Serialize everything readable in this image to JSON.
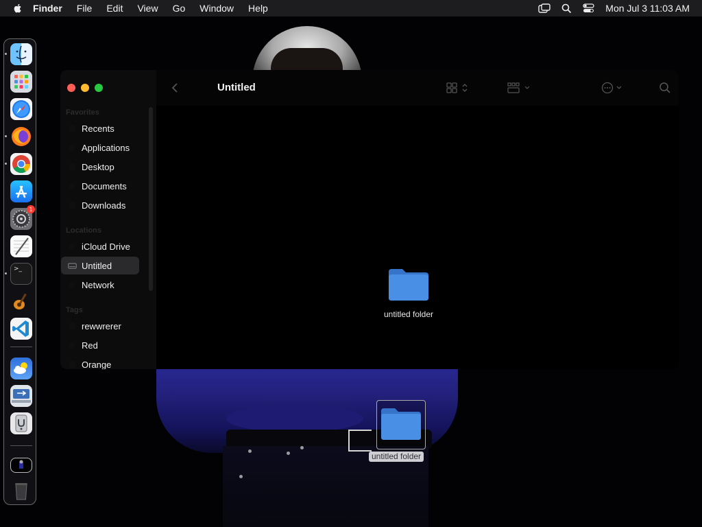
{
  "menubar": {
    "app_name": "Finder",
    "items": [
      "File",
      "Edit",
      "View",
      "Go",
      "Window",
      "Help"
    ],
    "clock": "Mon Jul 3  11:03 AM",
    "icons": [
      "screen-mirroring-icon",
      "spotlight-search-icon",
      "control-center-icon"
    ]
  },
  "dock": {
    "apps": [
      {
        "name": "Finder",
        "icon": "finder-icon"
      },
      {
        "name": "Launchpad",
        "icon": "launchpad-icon"
      },
      {
        "name": "Safari",
        "icon": "safari-icon"
      },
      {
        "name": "Firefox",
        "icon": "firefox-icon"
      },
      {
        "name": "Google Chrome",
        "icon": "chrome-icon"
      },
      {
        "name": "App Store",
        "icon": "app-store-icon"
      },
      {
        "name": "System Settings",
        "icon": "system-settings-icon",
        "badge": "1"
      },
      {
        "name": "TextEdit",
        "icon": "textedit-icon"
      },
      {
        "name": "Terminal",
        "icon": "terminal-icon",
        "glyph": ">_"
      },
      {
        "name": "GarageBand",
        "icon": "garageband-icon"
      },
      {
        "name": "Visual Studio Code",
        "icon": "vscode-icon"
      },
      {
        "name": "Weather",
        "icon": "weather-icon"
      },
      {
        "name": "Migration Assistant",
        "icon": "migration-assistant-icon"
      },
      {
        "name": "Disk Utility",
        "icon": "disk-utility-icon"
      },
      {
        "name": "Desktop Preview",
        "icon": "desktop-thumbnail-icon"
      },
      {
        "name": "Trash",
        "icon": "trash-icon"
      }
    ]
  },
  "finder": {
    "title": "Untitled",
    "sidebar": {
      "sections": [
        {
          "heading": "Favorites",
          "items": [
            "Recents",
            "Applications",
            "Desktop",
            "Documents",
            "Downloads"
          ]
        },
        {
          "heading": "Locations",
          "items": [
            "iCloud Drive",
            "Untitled",
            "Network"
          ]
        },
        {
          "heading": "Tags",
          "items": [
            "rewwrerer",
            "Red",
            "Orange"
          ]
        }
      ],
      "selected": "Untitled"
    },
    "content": {
      "items": [
        {
          "name": "untitled folder",
          "kind": "folder"
        }
      ]
    }
  },
  "desktop": {
    "dragged_item": {
      "name": "untitled folder",
      "kind": "folder"
    }
  },
  "colors": {
    "folder_blue": "#4a8fe6",
    "folder_blue_dark": "#3674c9",
    "traffic_close": "#ff5f57",
    "traffic_min": "#febc2e",
    "traffic_max": "#28c840",
    "badge": "#ff3b30"
  }
}
